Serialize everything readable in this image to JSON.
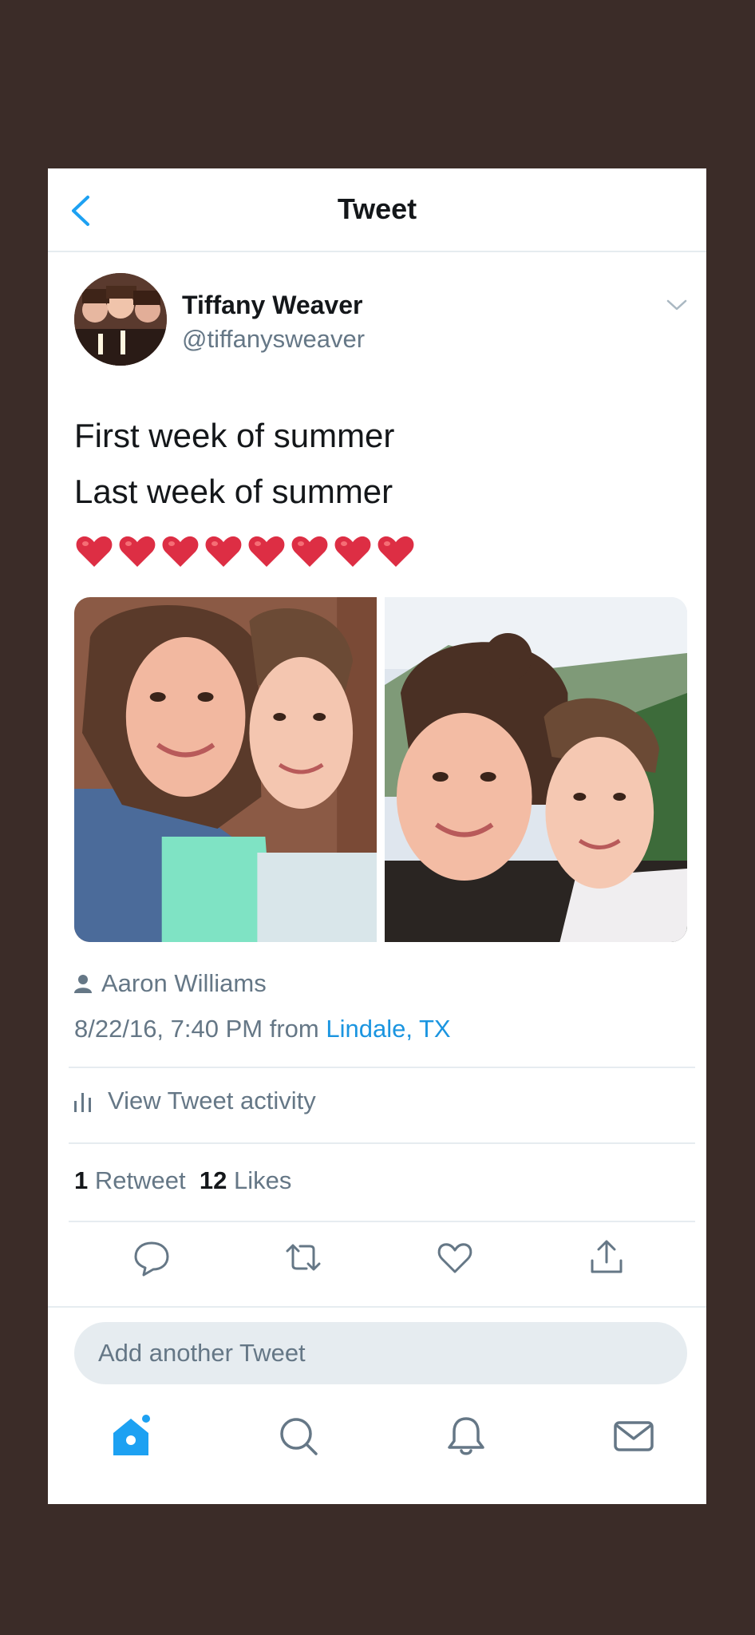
{
  "nav": {
    "title": "Tweet"
  },
  "author": {
    "name": "Tiffany Weaver",
    "handle": "@tiffanysweaver"
  },
  "tweet": {
    "lines": [
      "First week of summer",
      "Last week of summer"
    ],
    "emoji": [
      "❤️",
      "❤️",
      "❤️",
      "❤️",
      "❤️",
      "❤️",
      "❤️",
      "❤️"
    ]
  },
  "meta": {
    "tagged_user": "Aaron Williams",
    "date": "8/22/16, 7:40 PM from",
    "location": "Lindale, TX"
  },
  "activity_label": "View Tweet activity",
  "stats": {
    "retweets_count": "1",
    "retweets_label": "Retweet",
    "likes_count": "12",
    "likes_label": "Likes"
  },
  "reply_box": {
    "placeholder": "Add another Tweet"
  },
  "colors": {
    "accent": "#1da1f2",
    "link": "#1b95e0",
    "secondary_text": "#657786",
    "heart": "#e0245e"
  },
  "icons": {
    "actions": [
      "reply-icon",
      "retweet-icon",
      "like-icon",
      "share-icon"
    ],
    "tabs": [
      "home-icon",
      "search-icon",
      "notifications-icon",
      "messages-icon"
    ]
  }
}
